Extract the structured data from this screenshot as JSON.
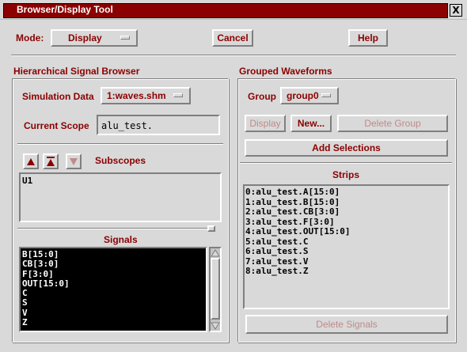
{
  "window": {
    "title": "Browser/Display Tool",
    "close_glyph": "X"
  },
  "toolbar": {
    "mode_label": "Mode:",
    "mode_value": "Display",
    "cancel_label": "Cancel",
    "help_label": "Help"
  },
  "browser": {
    "heading": "Hierarchical Signal Browser",
    "sim_data_label": "Simulation Data",
    "sim_data_value": "1:waves.shm",
    "scope_label": "Current Scope",
    "scope_value": "alu_test.",
    "subscopes_label": "Subscopes",
    "subscopes": [
      "U1"
    ],
    "signals_label": "Signals",
    "signals": [
      "B[15:0]",
      "CB[3:0]",
      "F[3:0]",
      "OUT[15:0]",
      "C",
      "S",
      "V",
      "Z"
    ]
  },
  "grouped": {
    "heading": "Grouped Waveforms",
    "group_label": "Group",
    "group_value": "group0",
    "display_label": "Display",
    "new_label": "New...",
    "delete_group_label": "Delete Group",
    "add_selections_label": "Add Selections",
    "strips_label": "Strips",
    "strips": [
      "0:alu_test.A[15:0]",
      "1:alu_test.B[15:0]",
      "2:alu_test.CB[3:0]",
      "3:alu_test.F[3:0]",
      "4:alu_test.OUT[15:0]",
      "5:alu_test.C",
      "6:alu_test.S",
      "7:alu_test.V",
      "8:alu_test.Z"
    ],
    "delete_signals_label": "Delete Signals"
  },
  "colors": {
    "accent": "#8b0000",
    "background": "#d9d9d9",
    "list_bg": "#000000",
    "list_fg": "#ffffff"
  }
}
